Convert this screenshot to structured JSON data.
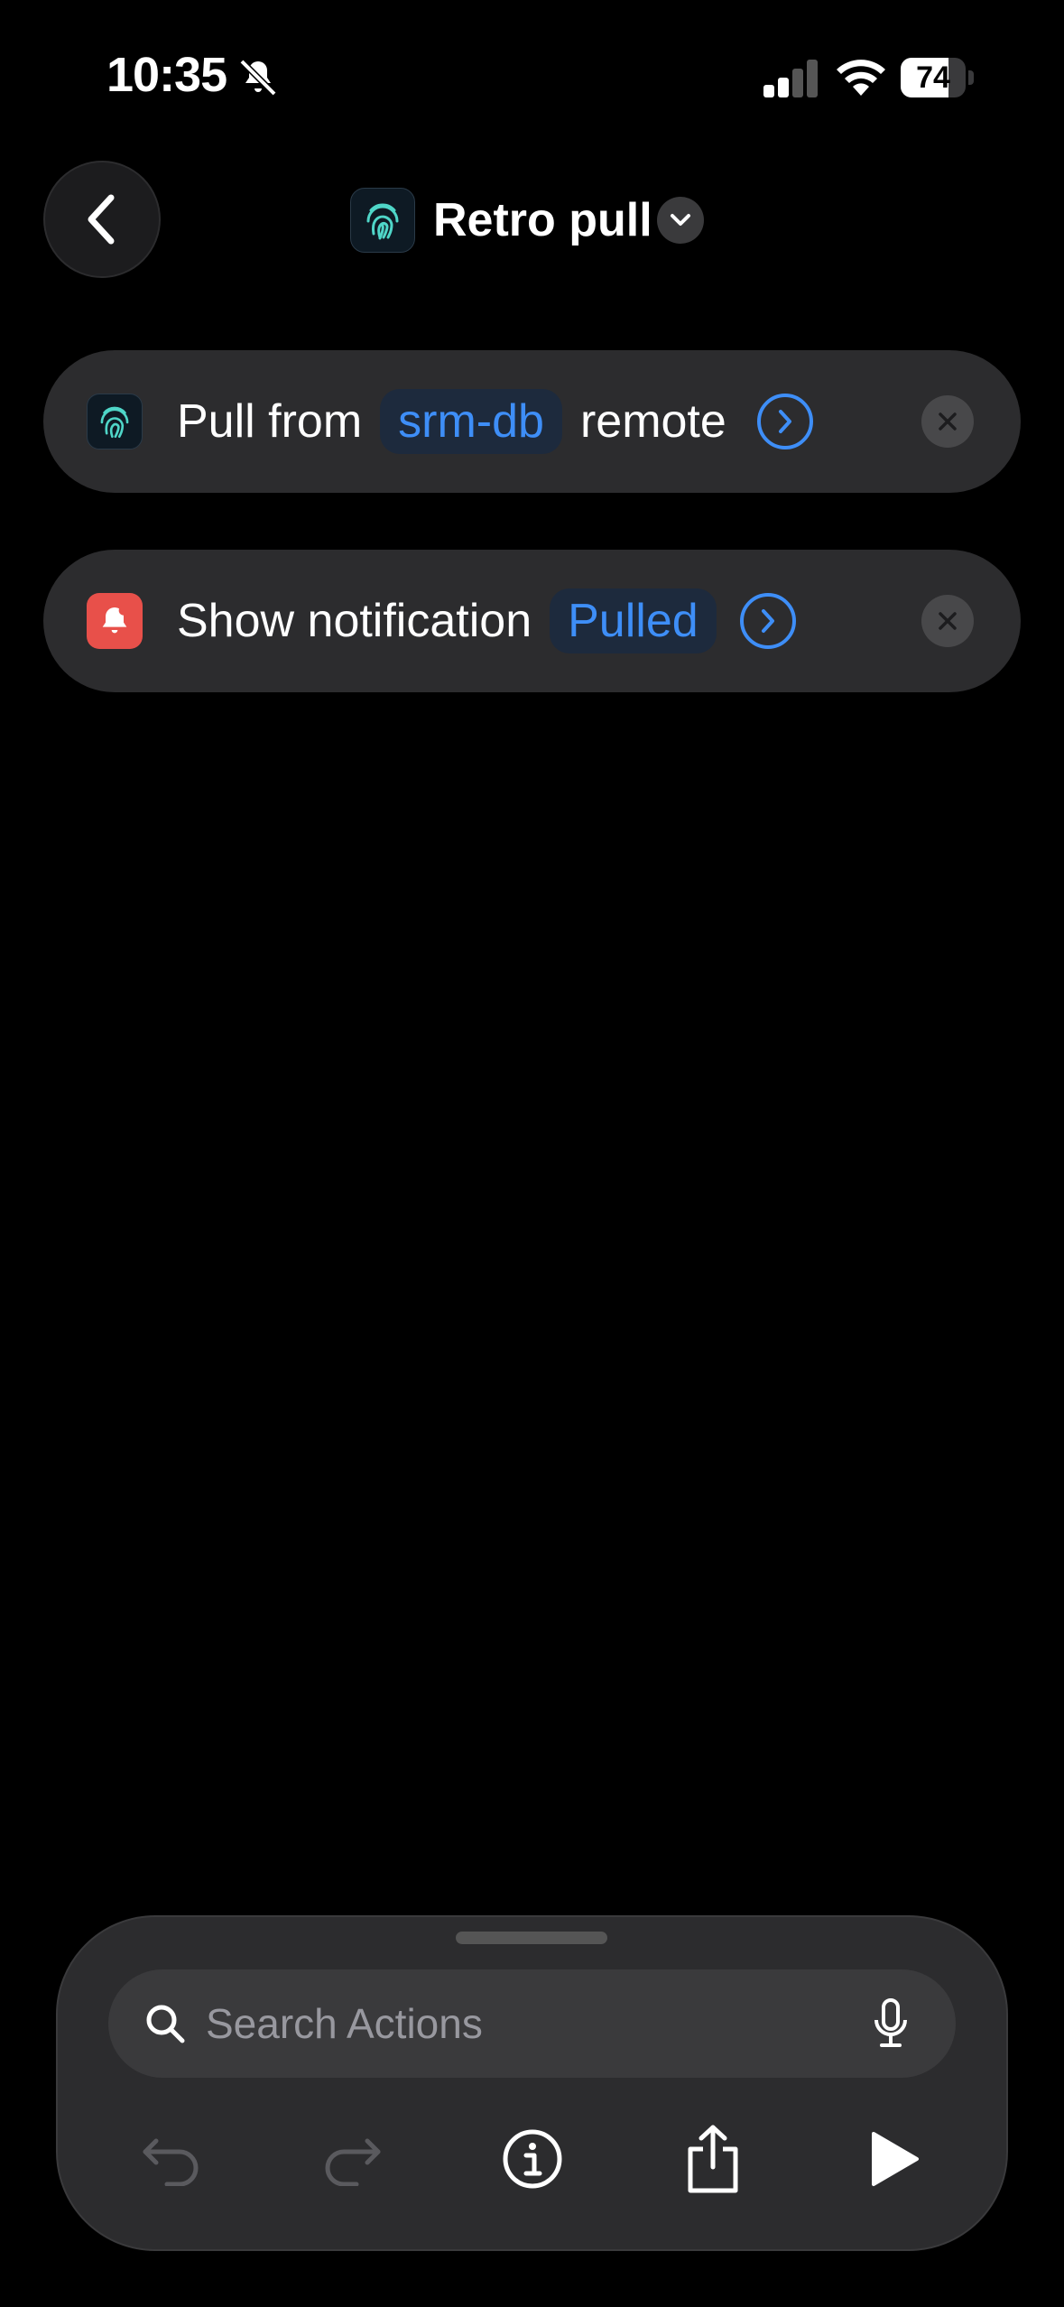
{
  "status_bar": {
    "time": "10:35",
    "battery": "74",
    "battery_level": 0.74
  },
  "header": {
    "title": "Retro pull"
  },
  "actions": [
    {
      "prefix": "Pull from",
      "token": "srm-db",
      "suffix": "remote",
      "icon": "fingerprint-icon"
    },
    {
      "prefix": "Show notification",
      "token": "Pulled",
      "icon": "bell-icon"
    }
  ],
  "search": {
    "placeholder": "Search Actions"
  },
  "toolbar": {
    "buttons": [
      "undo-icon",
      "redo-icon",
      "info-icon",
      "share-icon",
      "play-icon"
    ]
  },
  "colors": {
    "accent": "#3e8ef7",
    "card": "#2c2c2e",
    "notification": "#e8504a"
  }
}
